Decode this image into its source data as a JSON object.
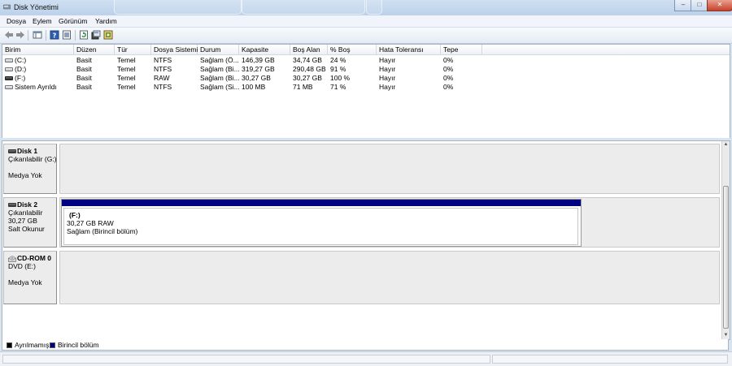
{
  "window": {
    "title": "Disk Yönetimi"
  },
  "menu": [
    "Dosya",
    "Eylem",
    "Görünüm",
    "Yardım"
  ],
  "toolbar": {
    "icons": [
      "back-arrow-icon",
      "forward-arrow-icon",
      "console-tree-icon",
      "help-icon",
      "properties-icon",
      "refresh-icon",
      "settings-icon",
      "rescan-icon"
    ]
  },
  "volume_table": {
    "columns": [
      "Birim",
      "Düzen",
      "Tür",
      "Dosya Sistemi",
      "Durum",
      "Kapasite",
      "Boş Alan",
      "% Boş",
      "Hata Toleransı",
      "Tepe"
    ],
    "rows": [
      {
        "birim": "(C:)",
        "duzen": "Basit",
        "tur": "Temel",
        "dosya": "NTFS",
        "durum": "Sağlam (Ö...",
        "kapasite": "146,39 GB",
        "bos": "34,74 GB",
        "yuzde": "24 %",
        "hata": "Hayır",
        "tepe": "0%",
        "icon": "drive-icon"
      },
      {
        "birim": "(D:)",
        "duzen": "Basit",
        "tur": "Temel",
        "dosya": "NTFS",
        "durum": "Sağlam (Bi...",
        "kapasite": "319,27 GB",
        "bos": "290,48 GB",
        "yuzde": "91 %",
        "hata": "Hayır",
        "tepe": "0%",
        "icon": "drive-icon"
      },
      {
        "birim": "(F:)",
        "duzen": "Basit",
        "tur": "Temel",
        "dosya": "RAW",
        "durum": "Sağlam (Bi...",
        "kapasite": "30,27 GB",
        "bos": "30,27 GB",
        "yuzde": "100 %",
        "hata": "Hayır",
        "tepe": "0%",
        "icon": "removable-drive-icon"
      },
      {
        "birim": "Sistem Ayrıldı",
        "duzen": "Basit",
        "tur": "Temel",
        "dosya": "NTFS",
        "durum": "Sağlam (Si...",
        "kapasite": "100 MB",
        "bos": "71 MB",
        "yuzde": "71 %",
        "hata": "Hayır",
        "tepe": "0%",
        "icon": "drive-icon"
      }
    ]
  },
  "disks": [
    {
      "name": "Disk 1",
      "lines": [
        "Çıkarılabilir (G:)",
        "",
        "Medya Yok"
      ],
      "icon": "disk-icon"
    },
    {
      "name": "Disk 2",
      "lines": [
        "Çıkarılabilir",
        "30,27 GB",
        "Salt Okunur"
      ],
      "icon": "disk-icon",
      "partition": {
        "title": "(F:)",
        "size": "30,27 GB RAW",
        "status": "Sağlam (Birincil bölüm)"
      }
    },
    {
      "name": "CD-ROM 0",
      "lines": [
        "DVD (E:)",
        "",
        "Medya Yok"
      ],
      "icon": "cd-rom-icon"
    }
  ],
  "legend": [
    {
      "label": "Ayrılmamış",
      "color": "#000000"
    },
    {
      "label": "Birincil bölüm",
      "color": "#000080"
    }
  ],
  "colors": {
    "primary_partition": "#000080",
    "unallocated": "#000000"
  }
}
